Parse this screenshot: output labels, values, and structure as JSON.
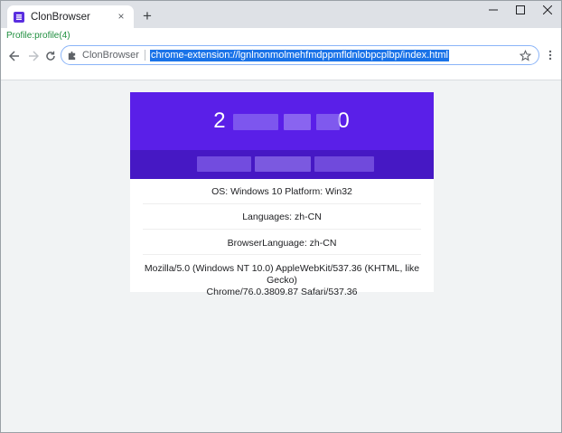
{
  "tab": {
    "title": "ClonBrowser",
    "close_label": "×",
    "new_tab_label": "+"
  },
  "window_controls": {
    "minimize": "—",
    "maximize": "☐",
    "close": "✕"
  },
  "profile": {
    "text": "Profile:profile(4)"
  },
  "omnibox": {
    "site_name": "ClonBrowser",
    "url": "chrome-extension://lgnlnonmolmehfmdppmfldnlobpcplbp/index.html"
  },
  "card": {
    "ip_text": "2                0",
    "os": "OS: Windows 10 Platform: Win32",
    "languages": "Languages: zh-CN",
    "browser_language": "BrowserLanguage: zh-CN",
    "user_agent_line1": "Mozilla/5.0 (Windows NT 10.0) AppleWebKit/537.36 (KHTML, like Gecko)",
    "user_agent_line2": "Chrome/76.0.3809.87 Safari/537.36"
  },
  "colors": {
    "accent": "#5a1fe8",
    "accent_dark": "#4618c4",
    "url_highlight": "#1a73e8",
    "profile_green": "#1e8e3e"
  }
}
